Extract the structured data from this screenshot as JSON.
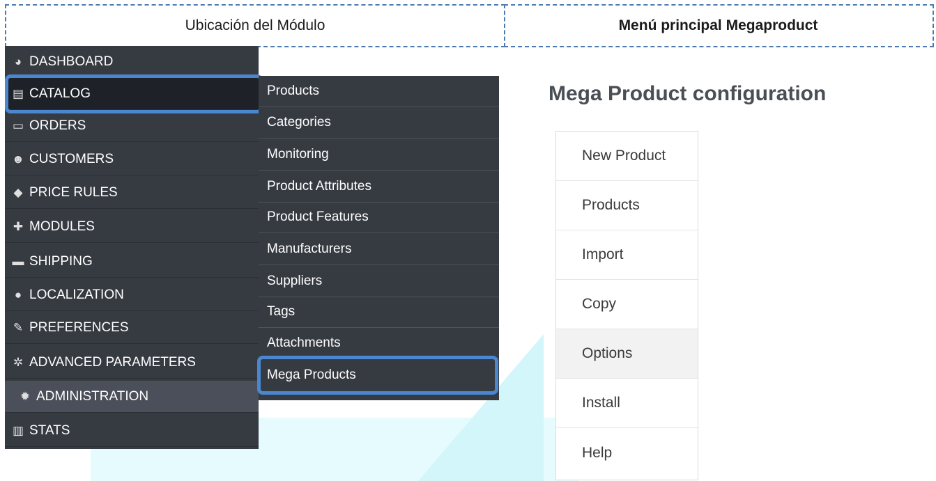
{
  "header": {
    "left_label": "Ubicación del Módulo",
    "right_label": "Menú principal Megaproduct"
  },
  "sidebar": {
    "items": [
      {
        "label": "DASHBOARD",
        "icon": "dashboard-icon"
      },
      {
        "label": "CATALOG",
        "icon": "book-icon"
      },
      {
        "label": "ORDERS",
        "icon": "credit-card-icon"
      },
      {
        "label": "CUSTOMERS",
        "icon": "users-icon"
      },
      {
        "label": "PRICE RULES",
        "icon": "tags-icon"
      },
      {
        "label": "MODULES",
        "icon": "puzzle-icon"
      },
      {
        "label": "SHIPPING",
        "icon": "truck-icon"
      },
      {
        "label": "LOCALIZATION",
        "icon": "globe-icon"
      },
      {
        "label": "PREFERENCES",
        "icon": "wrench-icon"
      },
      {
        "label": "ADVANCED PARAMETERS",
        "icon": "cogs-icon"
      },
      {
        "label": "ADMINISTRATION",
        "icon": "gear-icon"
      },
      {
        "label": "STATS",
        "icon": "bar-chart-icon"
      }
    ]
  },
  "submenu": {
    "items": [
      "Products",
      "Categories",
      "Monitoring",
      "Product Attributes",
      "Product Features",
      "Manufacturers",
      "Suppliers",
      "Tags",
      "Attachments",
      "Mega Products"
    ]
  },
  "config": {
    "title": "Mega Product configuration",
    "menu": [
      "New Product",
      "Products",
      "Import",
      "Copy",
      "Options",
      "Install",
      "Help"
    ],
    "selected": "Options"
  },
  "colors": {
    "sidebar_bg": "#363a41",
    "highlight": "#4a87d0"
  }
}
